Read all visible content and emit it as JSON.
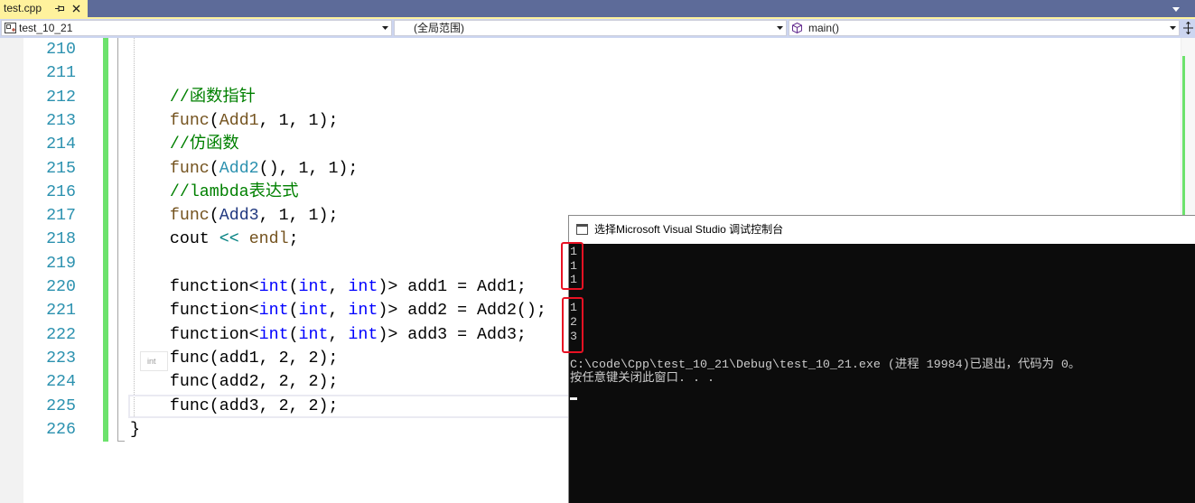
{
  "tabs": [
    {
      "label": "test.cpp",
      "active": true
    }
  ],
  "nav": {
    "project": "test_10_21",
    "scope": "(全局范围)",
    "member": "main()"
  },
  "icons": {
    "tab_pin": "pin-icon",
    "tab_close": "close-icon",
    "tab_overflow": "chevron-down-icon",
    "project": "project-icon",
    "member": "method-icon",
    "dropdown": "chevron-down-icon",
    "split": "split-window-icon",
    "console": "console-window-icon"
  },
  "colors": {
    "tab_strip": "#5D6B99",
    "tab_active": "#FFF29D",
    "nav_bar": "#CCD5F0",
    "line_number": "#2B91AF",
    "change_bar": "#6CE26C",
    "current_line_border": "#EAEAF2",
    "console_bg": "#0C0C0C",
    "console_fg": "#CCCCCC",
    "highlight_box": "#E81123"
  },
  "syntax_colors": {
    "ws": "#000000",
    "plain": "#000000",
    "comment": "#008000",
    "function": "#74531F",
    "type": "#2B91AF",
    "local": "#1F377F",
    "keyword": "#0000FF",
    "operator": "#008080"
  },
  "editor": {
    "lines": [
      {
        "n": "210",
        "tokens": []
      },
      {
        "n": "211",
        "tokens": []
      },
      {
        "n": "212",
        "tokens": [
          {
            "t": "    ",
            "k": "ws"
          },
          {
            "t": "//函数指针",
            "k": "comment"
          }
        ]
      },
      {
        "n": "213",
        "tokens": [
          {
            "t": "    ",
            "k": "ws"
          },
          {
            "t": "func",
            "k": "function"
          },
          {
            "t": "(",
            "k": "plain"
          },
          {
            "t": "Add1",
            "k": "function"
          },
          {
            "t": ", 1, 1);",
            "k": "plain"
          }
        ]
      },
      {
        "n": "214",
        "tokens": [
          {
            "t": "    ",
            "k": "ws"
          },
          {
            "t": "//仿函数",
            "k": "comment"
          }
        ]
      },
      {
        "n": "215",
        "tokens": [
          {
            "t": "    ",
            "k": "ws"
          },
          {
            "t": "func",
            "k": "function"
          },
          {
            "t": "(",
            "k": "plain"
          },
          {
            "t": "Add2",
            "k": "type"
          },
          {
            "t": "(), 1, 1);",
            "k": "plain"
          }
        ]
      },
      {
        "n": "216",
        "tokens": [
          {
            "t": "    ",
            "k": "ws"
          },
          {
            "t": "//lambda表达式",
            "k": "comment"
          }
        ]
      },
      {
        "n": "217",
        "tokens": [
          {
            "t": "    ",
            "k": "ws"
          },
          {
            "t": "func",
            "k": "function"
          },
          {
            "t": "(",
            "k": "plain"
          },
          {
            "t": "Add3",
            "k": "local"
          },
          {
            "t": ", 1, 1);",
            "k": "plain"
          }
        ]
      },
      {
        "n": "218",
        "tokens": [
          {
            "t": "    ",
            "k": "ws"
          },
          {
            "t": "cout",
            "k": "plain"
          },
          {
            "t": " ",
            "k": "ws"
          },
          {
            "t": "<<",
            "k": "operator"
          },
          {
            "t": " ",
            "k": "ws"
          },
          {
            "t": "endl",
            "k": "function"
          },
          {
            "t": ";",
            "k": "plain"
          }
        ]
      },
      {
        "n": "219",
        "tokens": []
      },
      {
        "n": "220",
        "tokens": [
          {
            "t": "    ",
            "k": "ws"
          },
          {
            "t": "function<",
            "k": "plain"
          },
          {
            "t": "int",
            "k": "keyword"
          },
          {
            "t": "(",
            "k": "plain"
          },
          {
            "t": "int",
            "k": "keyword"
          },
          {
            "t": ", ",
            "k": "plain"
          },
          {
            "t": "int",
            "k": "keyword"
          },
          {
            "t": ")> add1 = Add1;",
            "k": "plain"
          }
        ]
      },
      {
        "n": "221",
        "tokens": [
          {
            "t": "    ",
            "k": "ws"
          },
          {
            "t": "function<",
            "k": "plain"
          },
          {
            "t": "int",
            "k": "keyword"
          },
          {
            "t": "(",
            "k": "plain"
          },
          {
            "t": "int",
            "k": "keyword"
          },
          {
            "t": ", ",
            "k": "plain"
          },
          {
            "t": "int",
            "k": "keyword"
          },
          {
            "t": ")> add2 = Add2();",
            "k": "plain"
          }
        ]
      },
      {
        "n": "222",
        "tokens": [
          {
            "t": "    ",
            "k": "ws"
          },
          {
            "t": "function<",
            "k": "plain"
          },
          {
            "t": "int",
            "k": "keyword"
          },
          {
            "t": "(",
            "k": "plain"
          },
          {
            "t": "int",
            "k": "keyword"
          },
          {
            "t": ", ",
            "k": "plain"
          },
          {
            "t": "int",
            "k": "keyword"
          },
          {
            "t": ")> add3 = Add3;",
            "k": "plain"
          }
        ]
      },
      {
        "n": "223",
        "tokens": [
          {
            "t": "    ",
            "k": "ws"
          },
          {
            "t": "func(add1, 2, 2);",
            "k": "plain"
          }
        ]
      },
      {
        "n": "224",
        "tokens": [
          {
            "t": "    ",
            "k": "ws"
          },
          {
            "t": "func(add2, 2, 2);",
            "k": "plain"
          }
        ]
      },
      {
        "n": "225",
        "current": true,
        "tokens": [
          {
            "t": "    ",
            "k": "ws"
          },
          {
            "t": "func(add3, 2, 2);",
            "k": "plain"
          }
        ]
      },
      {
        "n": "226",
        "tokens": [
          {
            "t": "}",
            "k": "plain"
          }
        ]
      }
    ],
    "hint": "int"
  },
  "console": {
    "title": "选择Microsoft Visual Studio 调试控制台",
    "lines": [
      "1",
      "1",
      "1",
      "",
      "1",
      "2",
      "3",
      "",
      "C:\\code\\Cpp\\test_10_21\\Debug\\test_10_21.exe (进程 19984)已退出，代码为 0。",
      "按任意键关闭此窗口. . ."
    ]
  }
}
